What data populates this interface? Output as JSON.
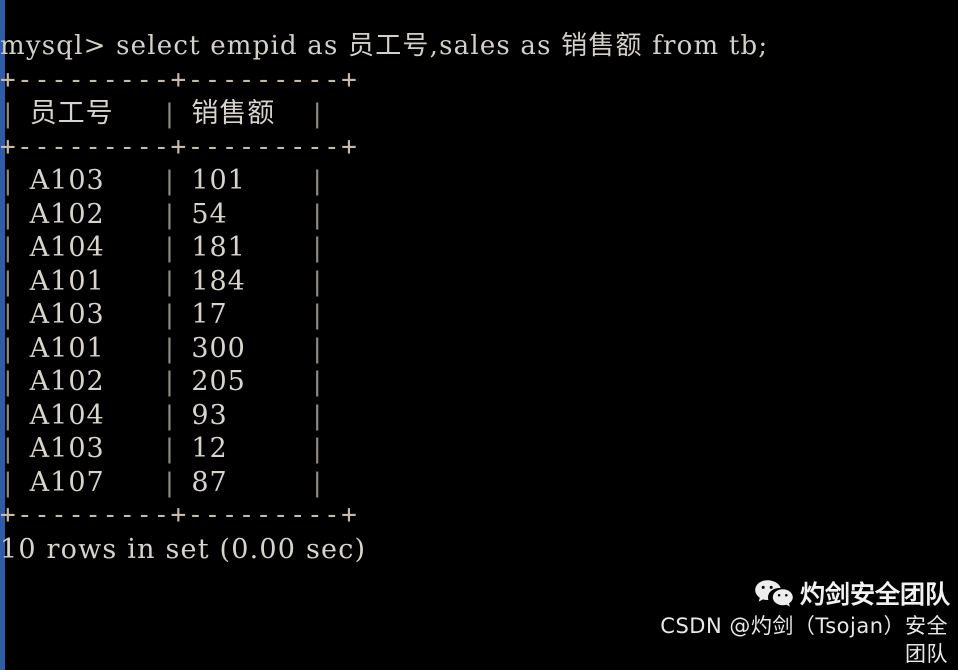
{
  "terminal": {
    "background_color": "#000000",
    "text_color": "#d8d4cc",
    "border_color": "#c9b9a8",
    "left_edge_color": "#2d5ca8",
    "prompt": "mysql>",
    "command": "mysql> select empid as 员工号,sales as 销售额 from tb;",
    "rule": "+---------+---------+",
    "footer": "10 rows in set (0.00 sec)"
  },
  "table": {
    "columns": [
      "员工号",
      "销售额"
    ],
    "rows": [
      {
        "empid": "A103",
        "sales": "101"
      },
      {
        "empid": "A102",
        "sales": "54"
      },
      {
        "empid": "A104",
        "sales": "181"
      },
      {
        "empid": "A101",
        "sales": "184"
      },
      {
        "empid": "A103",
        "sales": "17"
      },
      {
        "empid": "A101",
        "sales": "300"
      },
      {
        "empid": "A102",
        "sales": "205"
      },
      {
        "empid": "A104",
        "sales": "93"
      },
      {
        "empid": "A103",
        "sales": "12"
      },
      {
        "empid": "A107",
        "sales": "87"
      }
    ],
    "row_count": 10,
    "bar": "|"
  },
  "watermark": {
    "brand": "灼剑安全团队",
    "csdn": "CSDN @灼剑（Tsojan）安全团队",
    "icon": "wechat-icon"
  }
}
